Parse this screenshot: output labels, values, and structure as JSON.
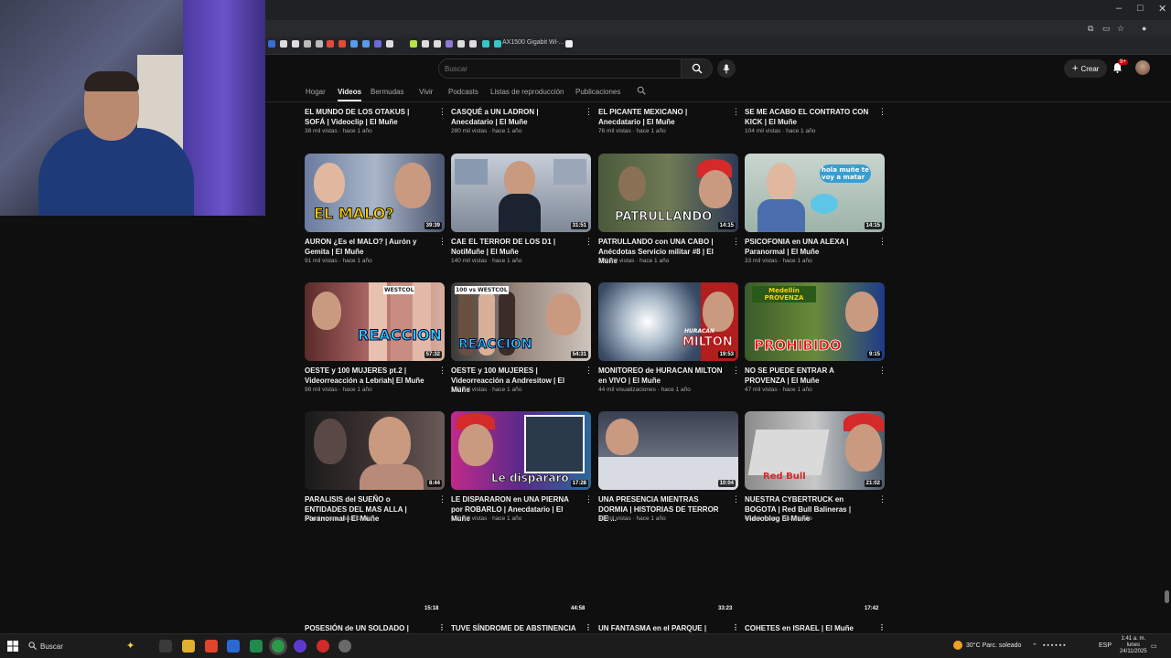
{
  "browser": {
    "window_controls": [
      "–",
      "□",
      "✕"
    ],
    "bookmark_label": "AX1500 Gigabit Wi-...",
    "accent": "#cc0000"
  },
  "header": {
    "search_placeholder": "Buscar",
    "create_label": "Crear",
    "notif_badge": "9+"
  },
  "tabs": {
    "items": [
      "Hogar",
      "Videos",
      "Bermudas",
      "Vivir",
      "Podcasts",
      "Listas de reproducción",
      "Publicaciones"
    ],
    "active": "Videos"
  },
  "top_row": [
    {
      "title": "EL MUNDO DE LOS OTAKUS | SOFÁ | Videoclip | El Muñe",
      "meta": "38 mil vistas · hace 1 año"
    },
    {
      "title": "CASQUÉ a UN LADRON | Anecdatario | El Muñe",
      "meta": "280 mil vistas · hace 1 año"
    },
    {
      "title": "EL PICANTE MEXICANO | Anecdatario | El Muñe",
      "meta": "76 mil vistas · hace 1 año"
    },
    {
      "title": "SE ME ACABO EL CONTRATO CON KICK | El Muñe",
      "meta": "104 mil vistas · hace 1 año"
    }
  ],
  "rows": [
    [
      {
        "title": "AURON ¿Es el MALO? | Aurón y Gemita | El Muñe",
        "meta": "91 mil vistas · hace 1 año",
        "duration": "39:39",
        "overlay": "EL MALO?"
      },
      {
        "title": "CAE EL TERROR DE LOS D1 | NotiMuñe | El Muñe",
        "meta": "140 mil vistas · hace 1 año",
        "duration": "31:51",
        "overlay": ""
      },
      {
        "title": "PATRULLANDO con UNA CABO | Anécdotas Servicio militar #8 | El Muñe",
        "meta": "222 mil vistas · hace 1 año",
        "duration": "14:15",
        "overlay": "PATRULLANDO"
      },
      {
        "title": "PSICOFONIA en UNA ALEXA | Paranormal | El Muñe",
        "meta": "33 mil vistas · hace 1 año",
        "duration": "14:15",
        "overlay": "hola muñe te voy a matar"
      }
    ],
    [
      {
        "title": "OESTE y 100 MUJERES pt.2 | Videorreacción a Lebriah| El Muñe",
        "meta": "98 mil vistas · hace 1 año",
        "duration": "57:32",
        "overlay": "REACCION Pt",
        "tag": "WESTCOL"
      },
      {
        "title": "OESTE y 100 MUJERES | Videorreacción a Andresitow | El Muñe",
        "meta": "157 mil vistas · hace 1 año",
        "duration": "54:31",
        "overlay": "REACCION",
        "tag": "100 vs WESTCOL"
      },
      {
        "title": "MONITOREO de HURACAN MILTON en VIVO | El Muñe",
        "meta": "44 mil visualizaciones · hace 1 año",
        "duration": "19:53",
        "overlay": "MILTON",
        "tag": "HURACAN"
      },
      {
        "title": "NO SE PUEDE ENTRAR A PROVENZA | El Muñe",
        "meta": "47 mil vistas · hace 1 año",
        "duration": "9:15",
        "overlay": "PROHIBIDO",
        "tag": "Medellín PROVENZA"
      }
    ],
    [
      {
        "title": "PARALISIS del SUEÑO o ENTIDADES DEL MAS ALLA | Paranormal | El Muñe",
        "meta": "17 mil vistas · hace 1 año",
        "duration": "8:44",
        "overlay": ""
      },
      {
        "title": "LE DISPARARON en UNA PIERNA por ROBARLO | Anecdatario | El Muñe",
        "meta": "155 mil vistas · hace 1 año",
        "duration": "17:28",
        "overlay": "Le dispararo"
      },
      {
        "title": "UNA PRESENCIA MIENTRAS DORMIA | HISTORIAS DE TERROR DE ...",
        "meta": "43 mil vistas · hace 1 año",
        "duration": "10:04",
        "overlay": ""
      },
      {
        "title": "NUESTRA CYBERTRUCK en BOGOTA | Red Bull Balineras | Videoblog El Muñe",
        "meta": "47 mil vistas · hace 1 año",
        "duration": "21:02",
        "overlay": "Red Bull"
      }
    ]
  ],
  "partial_row": [
    {
      "title": "POSESIÓN de UN SOLDADO |",
      "duration": "15:18"
    },
    {
      "title": "TUVE SÍNDROME DE ABSTINENCIA",
      "duration": "44:58"
    },
    {
      "title": "UN FANTASMA en el PARQUE |",
      "duration": "33:23"
    },
    {
      "title": "COHETES en ISRAEL | El Muñe",
      "duration": "17:42"
    }
  ],
  "taskbar": {
    "search_label": "Buscar",
    "weather": "30°C  Parc. soleado",
    "lang": "ESP",
    "time": "1:41 a. m.",
    "day": "lunes",
    "date": "24/11/2025"
  }
}
